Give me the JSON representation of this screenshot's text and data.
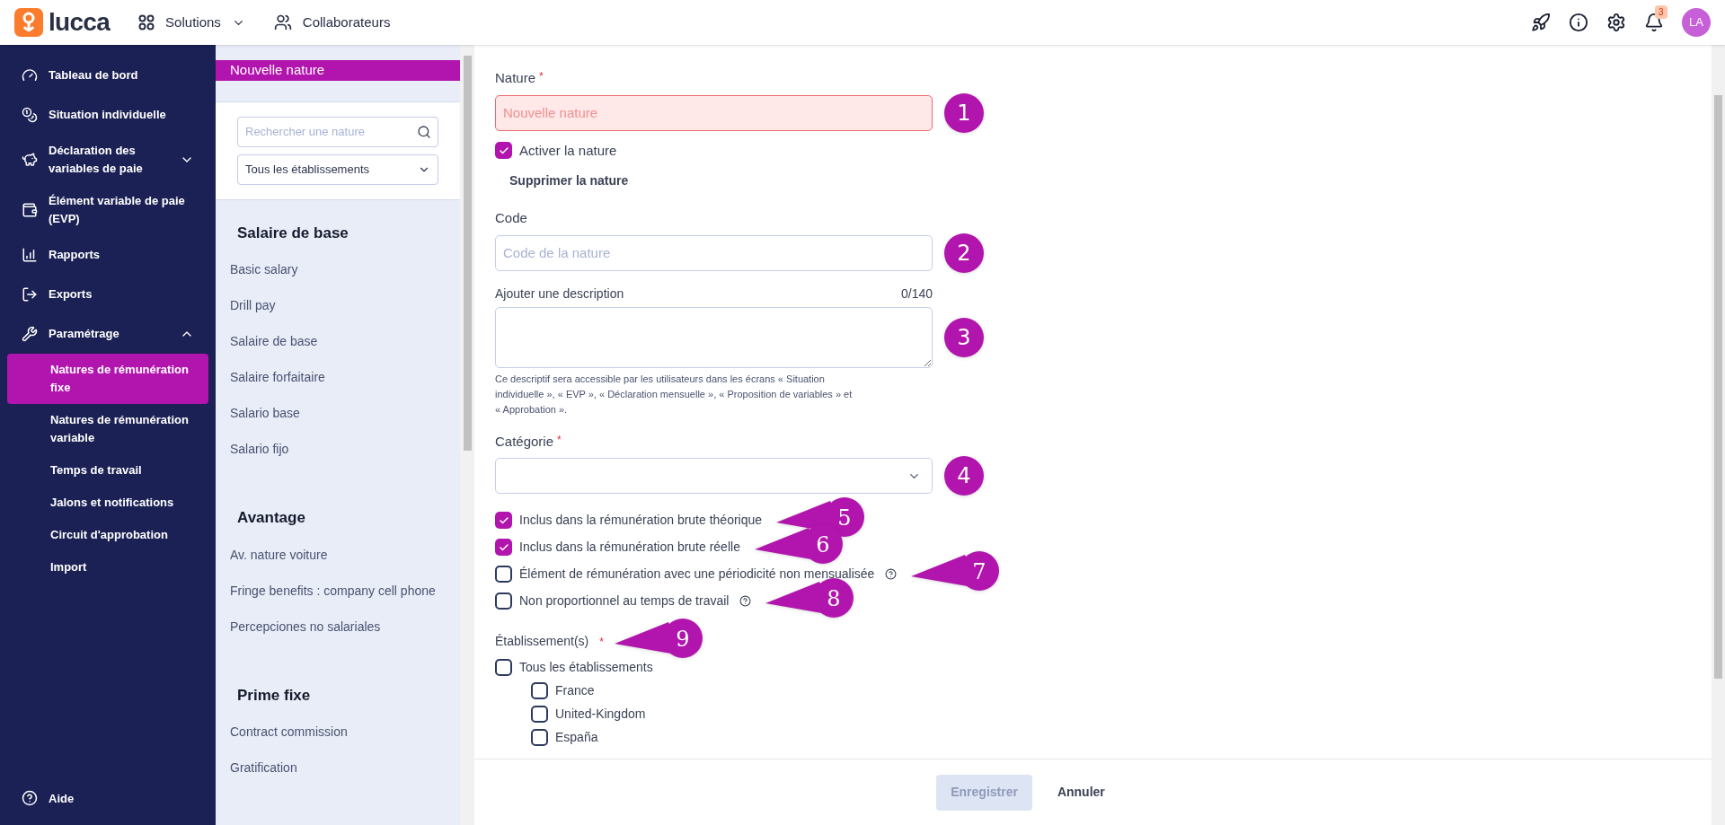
{
  "topbar": {
    "logo": "lucca",
    "nav": [
      {
        "label": "Solutions",
        "dropdown": true
      },
      {
        "label": "Collaborateurs",
        "dropdown": false
      }
    ],
    "notification_count": "3",
    "avatar": "LA"
  },
  "sidebar": {
    "items": [
      {
        "label": "Tableau de bord"
      },
      {
        "label": "Situation individuelle"
      },
      {
        "label": "Déclaration des variables de paie",
        "expanded": false
      },
      {
        "label": "Élément variable de paie (EVP)"
      },
      {
        "label": "Rapports"
      },
      {
        "label": "Exports"
      },
      {
        "label": "Paramétrage",
        "expanded": true,
        "children": [
          {
            "label": "Natures de rémunération fixe",
            "selected": true
          },
          {
            "label": "Natures de rémunération variable",
            "selected": false
          },
          {
            "label": "Temps de travail",
            "selected": false
          },
          {
            "label": "Jalons et notifications",
            "selected": false
          },
          {
            "label": "Circuit d'approbation",
            "selected": false
          },
          {
            "label": "Import",
            "selected": false
          }
        ]
      }
    ],
    "help": "Aide"
  },
  "list_panel": {
    "new_item": {
      "label": "Nouvelle nature",
      "selected": true
    },
    "search": {
      "placeholder": "Rechercher une nature"
    },
    "filter": {
      "value": "Tous les établissements"
    },
    "groups": [
      {
        "title": "Salaire de base",
        "items": [
          "Basic salary",
          "Drill pay",
          "Salaire de base",
          "Salaire forfaitaire",
          "Salario base",
          "Salario fijo"
        ]
      },
      {
        "title": "Avantage",
        "items": [
          "Av. nature voiture",
          "Fringe benefits : company cell phone",
          "Percepciones no salariales"
        ]
      },
      {
        "title": "Prime fixe",
        "items": [
          "Contract commission",
          "Gratification"
        ]
      }
    ]
  },
  "form": {
    "nature": {
      "label": "Nature",
      "required_mark": "*",
      "placeholder": "Nouvelle nature",
      "error": true,
      "callout": {
        "label": "1",
        "kind": "circle"
      }
    },
    "activate": {
      "label": "Activer la nature",
      "checked": true
    },
    "delete_link": "Supprimer la nature",
    "code": {
      "label": "Code",
      "placeholder": "Code de la nature",
      "error": false,
      "callout": {
        "label": "2",
        "kind": "circle"
      }
    },
    "description": {
      "label": "Ajouter une description",
      "counter": "0/140",
      "help": "Ce descriptif sera accessible par les utilisateurs dans les écrans « Situation individuelle », « EVP », « Déclaration mensuelle », « Proposition de variables » et « Approbation ».",
      "callout": {
        "label": "3",
        "kind": "circle"
      }
    },
    "category": {
      "label": "Catégorie",
      "required_mark": "*",
      "callout": {
        "label": "4",
        "kind": "circle"
      }
    },
    "options": [
      {
        "label": "Inclus dans la rémunération brute théorique",
        "checked": true,
        "info": false,
        "callout": {
          "label": "5",
          "kind": "pointer"
        }
      },
      {
        "label": "Inclus dans la rémunération brute réelle",
        "checked": true,
        "info": false,
        "callout": {
          "label": "6",
          "kind": "pointer"
        }
      },
      {
        "label": "Élément de rémunération avec une périodicité non mensualisée",
        "checked": false,
        "info": true,
        "callout": {
          "label": "7",
          "kind": "pointer"
        }
      },
      {
        "label": "Non proportionnel au temps de travail",
        "checked": false,
        "info": true,
        "callout": {
          "label": "8",
          "kind": "pointer"
        }
      }
    ],
    "establishments": {
      "label": "Établissement(s)",
      "required_mark": "*",
      "callout": {
        "label": "9",
        "kind": "pointer"
      },
      "all": {
        "label": "Tous les établissements",
        "checked": false
      },
      "children": [
        {
          "label": "France",
          "checked": false
        },
        {
          "label": "United-Kingdom",
          "checked": false
        },
        {
          "label": "España",
          "checked": false
        }
      ]
    }
  },
  "footer": {
    "buttons": [
      {
        "label": "Enregistrer",
        "disabled": true
      },
      {
        "label": "Annuler",
        "disabled": false
      }
    ]
  }
}
